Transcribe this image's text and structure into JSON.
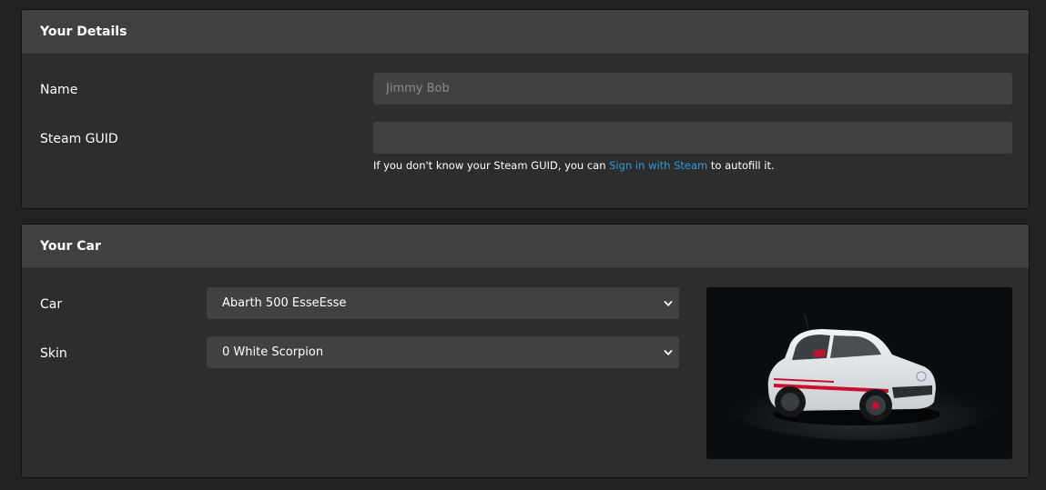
{
  "details": {
    "title": "Your Details",
    "name_label": "Name",
    "name_value": "",
    "name_placeholder": "Jimmy Bob",
    "guid_label": "Steam GUID",
    "guid_value": "",
    "guid_placeholder": "",
    "help_prefix": "If you don't know your Steam GUID, you can ",
    "help_link": "Sign in with Steam",
    "help_suffix": " to autofill it."
  },
  "car": {
    "title": "Your Car",
    "car_label": "Car",
    "car_selected": "Abarth 500 EsseEsse",
    "skin_label": "Skin",
    "skin_selected": "0 White Scorpion",
    "preview_icon": "car-image"
  },
  "colors": {
    "link": "#2f9bd8",
    "panel_bg": "#2d2d2d",
    "header_bg": "#404040",
    "input_bg": "#414141",
    "page_bg": "#222222"
  }
}
